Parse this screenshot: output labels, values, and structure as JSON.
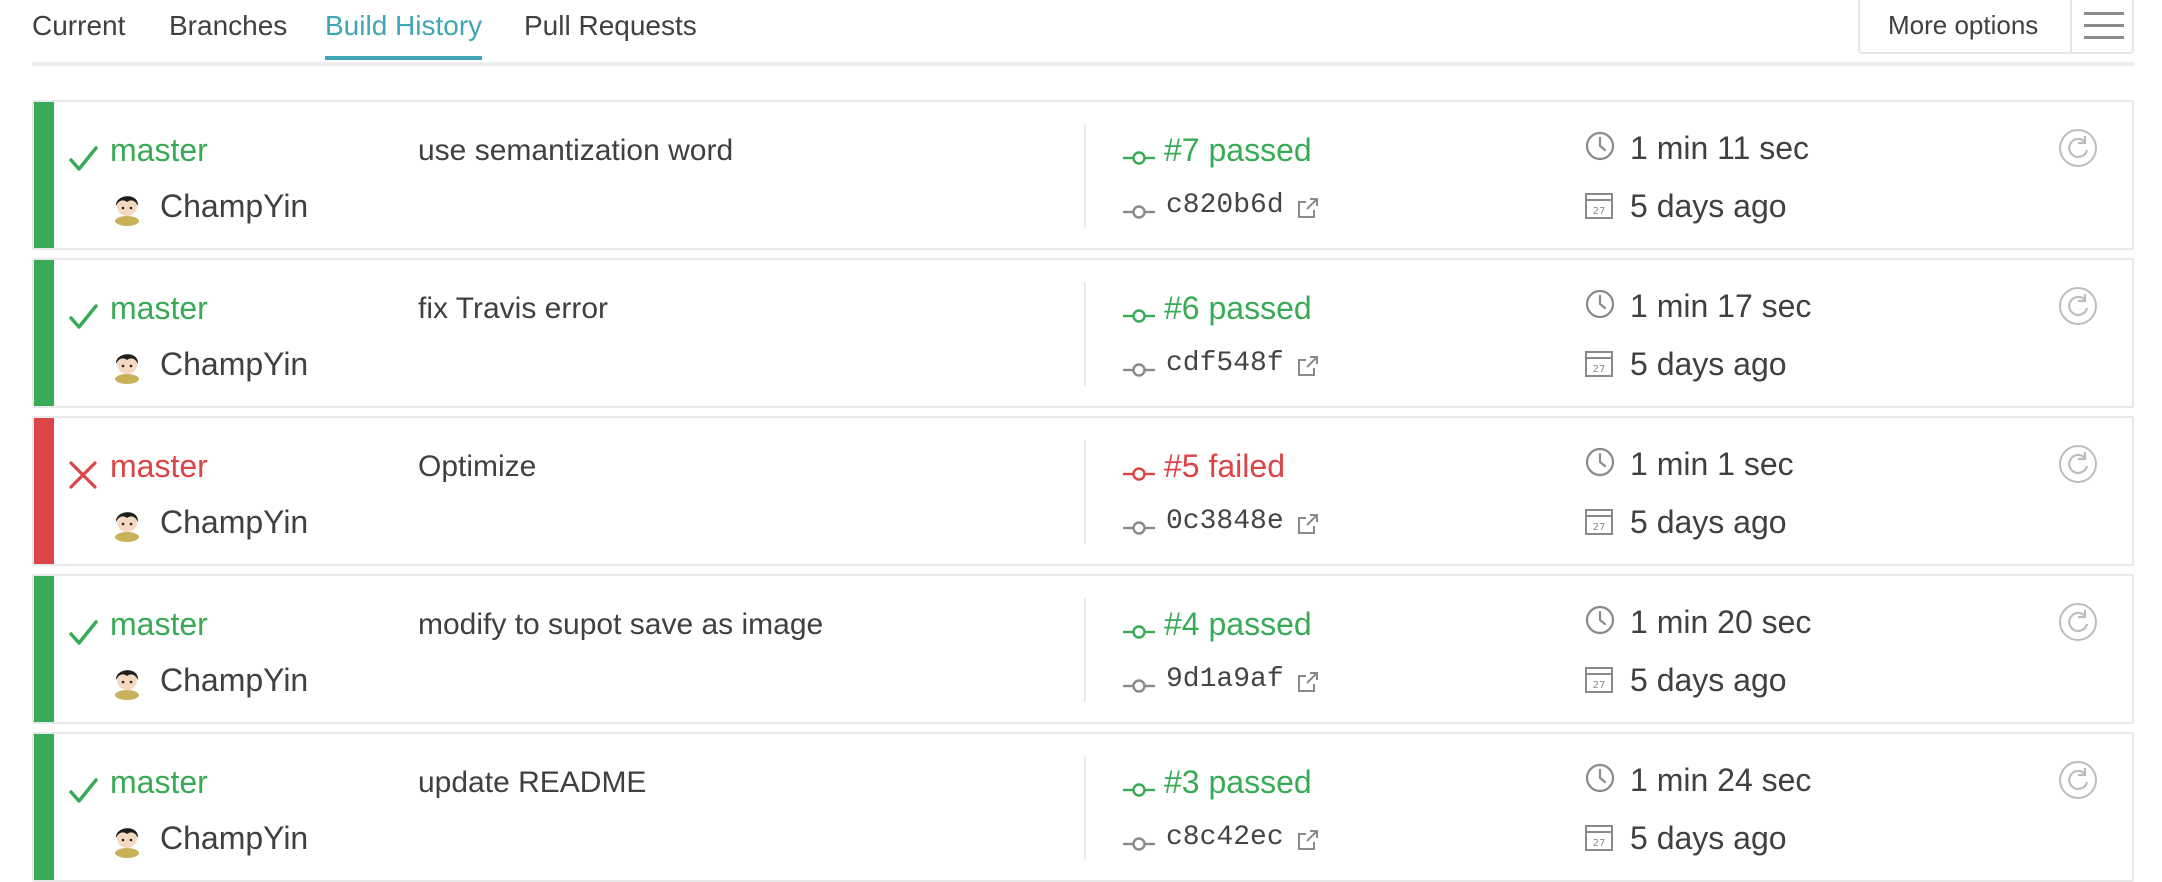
{
  "tabs": [
    {
      "label": "Current"
    },
    {
      "label": "Branches"
    },
    {
      "label": "Build History",
      "active": true
    },
    {
      "label": "Pull Requests"
    }
  ],
  "more_options": {
    "label": "More options",
    "icon": "hamburger-menu-icon"
  },
  "colors": {
    "passed": "#39aa56",
    "failed": "#db4545",
    "accent": "#3ea6b4"
  },
  "builds": [
    {
      "state": "passed",
      "branch": "master",
      "author": "ChampYin",
      "message": "use semantization word",
      "build": "#7 passed",
      "sha": "c820b6d",
      "duration": "1 min 11 sec",
      "finished": "5 days ago"
    },
    {
      "state": "passed",
      "branch": "master",
      "author": "ChampYin",
      "message": "fix Travis error",
      "build": "#6 passed",
      "sha": "cdf548f",
      "duration": "1 min 17 sec",
      "finished": "5 days ago"
    },
    {
      "state": "failed",
      "branch": "master",
      "author": "ChampYin",
      "message": "Optimize",
      "build": "#5 failed",
      "sha": "0c3848e",
      "duration": "1 min 1 sec",
      "finished": "5 days ago"
    },
    {
      "state": "passed",
      "branch": "master",
      "author": "ChampYin",
      "message": "modify to supot save as image",
      "build": "#4 passed",
      "sha": "9d1a9af",
      "duration": "1 min 20 sec",
      "finished": "5 days ago"
    },
    {
      "state": "passed",
      "branch": "master",
      "author": "ChampYin",
      "message": "update README",
      "build": "#3 passed",
      "sha": "c8c42ec",
      "duration": "1 min 24 sec",
      "finished": "5 days ago"
    }
  ],
  "calendar_icon_text": "27"
}
